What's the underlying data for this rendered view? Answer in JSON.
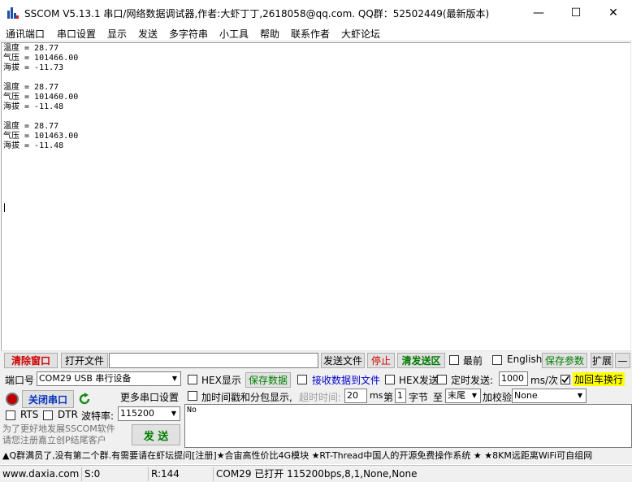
{
  "window": {
    "title": "SSCOM V5.13.1 串口/网络数据调试器,作者:大虾丁丁,2618058@qq.com. QQ群：52502449(最新版本)",
    "minimize": "—",
    "maximize": "☐",
    "close": "✕"
  },
  "menu": [
    "通讯端口",
    "串口设置",
    "显示",
    "发送",
    "多字符串",
    "小工具",
    "帮助",
    "联系作者",
    "大虾论坛"
  ],
  "receive": {
    "text": "温度 = 28.77\n气压 = 101466.00\n海拔 = -11.73\n\n温度 = 28.77\n气压 = 101460.00\n海拔 = -11.48\n\n温度 = 28.77\n气压 = 101463.00\n海拔 = -11.48"
  },
  "toolbar": {
    "clear_window": "清除窗口",
    "open_file": "打开文件",
    "send_file": "发送文件",
    "stop": "停止",
    "clear_send": "清发送区",
    "topmost": "最前",
    "english": "English",
    "save_params": "保存参数",
    "expand": "扩展",
    "collapse": "—"
  },
  "port": {
    "port_label": "端口号",
    "port_value": "COM29 USB 串行设备",
    "close_port": "关闭串口",
    "more_settings": "更多串口设置",
    "rts": "RTS",
    "dtr": "DTR",
    "baud_label": "波特率:",
    "baud_value": "115200"
  },
  "options": {
    "hex_display": "HEX显示",
    "save_data": "保存数据",
    "recv_to_file": "接收数据到文件",
    "hex_send": "HEX发送",
    "timed_send": "定时发送:",
    "interval_value": "1000",
    "interval_unit": "ms/次",
    "add_crlf": "加回车换行",
    "timestamp": "加时间戳和分包显示,",
    "timeout_label": "超时时间:",
    "timeout_value": "20",
    "timeout_unit": "ms",
    "byte_from_label": "第",
    "byte_from_value": "1",
    "byte_unit": "字节",
    "to_label": "至",
    "to_value": "末尾",
    "checksum_label": "加校验",
    "checksum_value": "None"
  },
  "send": {
    "text": "No",
    "send_button": "发  送",
    "promo": "为了更好地发展SSCOM软件\n请您注册嘉立创P结尾客户"
  },
  "ticker": "▲Q群满员了,没有第二个群.有需要请在虾坛提问[注册]★合宙高性价比4G模块 ★RT-Thread中国人的开源免费操作系统 ★ ★8KM远距离WiFi可自组网",
  "status": {
    "website": "www.daxia.com",
    "sent": "S:0",
    "received": "R:144",
    "port_state": "COM29 已打开  115200bps,8,1,None,None"
  }
}
